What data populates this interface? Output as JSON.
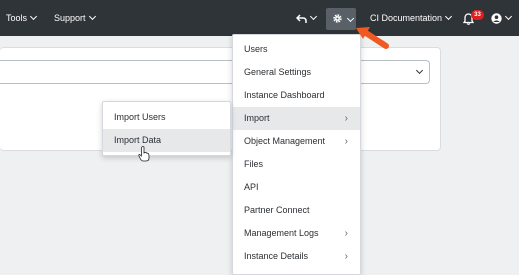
{
  "topbar": {
    "tools_label": "Tools",
    "support_label": "Support",
    "workspace_label": "CI Documentation",
    "notification_count": "33"
  },
  "settings_menu": {
    "items": [
      {
        "label": "Users"
      },
      {
        "label": "General Settings"
      },
      {
        "label": "Instance Dashboard"
      },
      {
        "label": "Import"
      },
      {
        "label": "Object Management"
      },
      {
        "label": "Files"
      },
      {
        "label": "API"
      },
      {
        "label": "Partner Connect"
      },
      {
        "label": "Management Logs"
      },
      {
        "label": "Instance Details"
      }
    ]
  },
  "import_submenu": {
    "items": [
      {
        "label": "Import Users"
      },
      {
        "label": "Import Data"
      }
    ]
  },
  "colors": {
    "topbar_bg": "#2f3439",
    "accent_arrow": "#f05a22",
    "badge_bg": "#e02020"
  },
  "icons": [
    "chevron-down-icon",
    "undo-icon",
    "gear-icon",
    "bell-icon",
    "user-icon",
    "chevron-right-icon",
    "pointer-hand-icon"
  ]
}
